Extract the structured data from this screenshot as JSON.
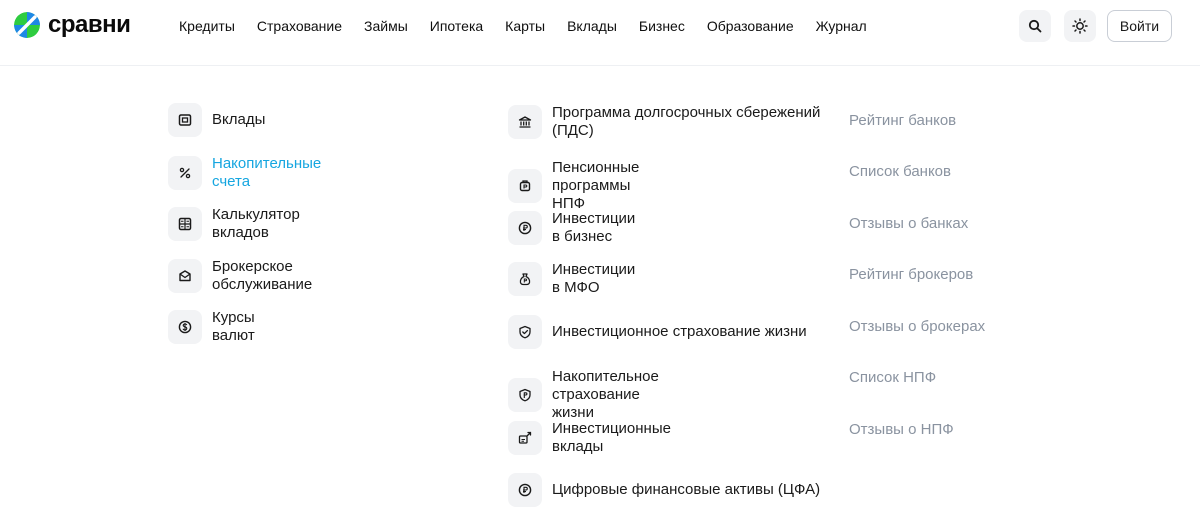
{
  "brand": {
    "name": "сравни"
  },
  "nav": {
    "items": [
      {
        "label": "Кредиты"
      },
      {
        "label": "Страхование"
      },
      {
        "label": "Займы"
      },
      {
        "label": "Ипотека"
      },
      {
        "label": "Карты"
      },
      {
        "label": "Вклады"
      },
      {
        "label": "Бизнес"
      },
      {
        "label": "Образование"
      },
      {
        "label": "Журнал"
      }
    ]
  },
  "header_actions": {
    "search_icon": "search-icon",
    "theme_icon": "sun-icon",
    "login_label": "Войти"
  },
  "menu": {
    "col1": [
      {
        "label": "Вклады",
        "icon": "deposit-icon"
      },
      {
        "label": "Накопительные счета",
        "icon": "percent-icon",
        "active": true
      },
      {
        "label": "Калькулятор вкладов",
        "icon": "calculator-icon"
      },
      {
        "label": "Брокерское обслуживание",
        "icon": "briefcase-icon"
      },
      {
        "label": "Курсы валют",
        "icon": "currency-icon"
      }
    ],
    "col2": [
      {
        "label": "Программа долгосрочных сбережений (ПДС)",
        "icon": "bank-icon"
      },
      {
        "label": "Пенсионные программы НПФ",
        "icon": "pension-icon"
      },
      {
        "label": "Инвестиции в бизнес",
        "icon": "ruble-coin-icon"
      },
      {
        "label": "Инвестиции в МФО",
        "icon": "money-bag-icon"
      },
      {
        "label": "Инвестиционное страхование жизни",
        "icon": "shield-check-icon"
      },
      {
        "label": "Накопительное страхование жизни",
        "icon": "shield-ruble-icon"
      },
      {
        "label": "Инвестиционные вклады",
        "icon": "growth-icon"
      },
      {
        "label": "Цифровые финансовые активы (ЦФА)",
        "icon": "digital-ruble-icon"
      }
    ],
    "col3": [
      {
        "label": "Рейтинг банков"
      },
      {
        "label": "Список банков"
      },
      {
        "label": "Отзывы о банках"
      },
      {
        "label": "Рейтинг брокеров"
      },
      {
        "label": "Отзывы о брокерах"
      },
      {
        "label": "Список НПФ"
      },
      {
        "label": "Отзывы о НПФ"
      }
    ]
  },
  "colors": {
    "accent": "#16a6e0",
    "muted": "#8a93a0",
    "tile_bg": "#f2f3f5",
    "logo_green": "#2ecc40",
    "logo_blue": "#1e88e5"
  }
}
